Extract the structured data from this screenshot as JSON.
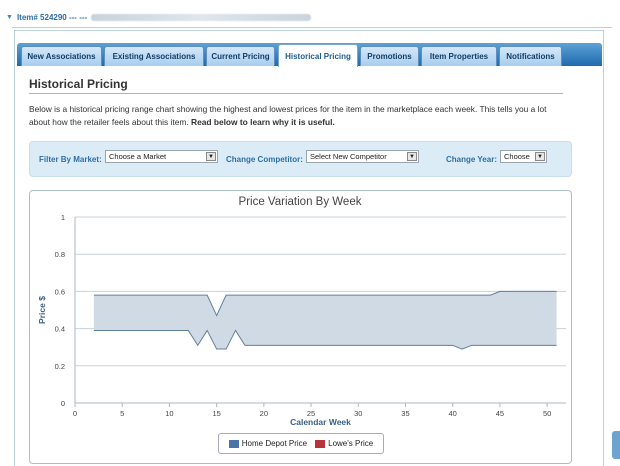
{
  "item_header": {
    "label": "Item# 524290 --- ---"
  },
  "tabs": [
    {
      "label": "New Associations"
    },
    {
      "label": "Existing Associations"
    },
    {
      "label": "Current Pricing"
    },
    {
      "label": "Historical Pricing"
    },
    {
      "label": "Promotions"
    },
    {
      "label": "Item Properties"
    },
    {
      "label": "Notifications"
    }
  ],
  "section": {
    "title": "Historical Pricing",
    "description": "Below is a historical pricing range chart showing the highest and lowest prices for the item in the marketplace each week. This tells you a lot about how the retailer feels about this item.",
    "description_bold": "Read below to learn why it is useful."
  },
  "filters": {
    "market_label": "Filter By Market:",
    "market_value": "Choose a Market",
    "competitor_label": "Change Competitor:",
    "competitor_value": "Select New Competitor",
    "year_label": "Change Year:",
    "year_value": "Choose"
  },
  "colors": {
    "home_depot": "#4a74a8",
    "lowes": "#b9343a",
    "band": "#cfdae5",
    "accent": "#2d6fa5"
  },
  "chart_data": {
    "type": "area",
    "title": "Price Variation By Week",
    "xlabel": "Calendar Week",
    "ylabel": "Price $",
    "xlim": [
      0,
      52
    ],
    "ylim": [
      0,
      1
    ],
    "xticks": [
      "0",
      "5",
      "10",
      "15",
      "20",
      "25",
      "30",
      "35",
      "40",
      "45",
      "50"
    ],
    "yticks": [
      "0",
      "0.2",
      "0.4",
      "0.6",
      "0.8",
      "1"
    ],
    "legend": [
      "Home Depot Price",
      "Lowe's Price"
    ],
    "series": [
      {
        "name": "Home Depot Price",
        "x": [
          2,
          12,
          13,
          14,
          15,
          16,
          17,
          18,
          40,
          41,
          42,
          44,
          45,
          51
        ],
        "low": [
          0.39,
          0.39,
          0.31,
          0.39,
          0.29,
          0.29,
          0.39,
          0.31,
          0.31,
          0.29,
          0.31,
          0.31,
          0.31,
          0.31
        ],
        "high": [
          0.58,
          0.58,
          0.58,
          0.58,
          0.58,
          0.58,
          0.58,
          0.58,
          0.58,
          0.58,
          0.58,
          0.58,
          0.6,
          0.6
        ]
      }
    ],
    "high_dip": {
      "x": [
        14,
        15,
        16
      ],
      "y": [
        0.58,
        0.47,
        0.58
      ]
    }
  }
}
